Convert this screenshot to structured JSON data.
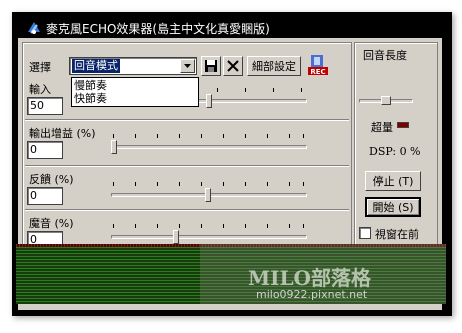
{
  "window": {
    "title": "麥克風ECHO效果器(島主中文化真愛睏版)"
  },
  "preset": {
    "label": "選擇",
    "value": "回音模式",
    "options": [
      "慢節奏",
      "快節奏"
    ]
  },
  "toolbar": {
    "settings_label": "細部設定"
  },
  "sliders": [
    {
      "label": "輸入",
      "value": "50",
      "level": 0.5
    },
    {
      "label": "輸出增益 (%)",
      "value": "0",
      "level": 0.0
    },
    {
      "label": "反饋 (%)",
      "value": "0",
      "level": 0.5
    },
    {
      "label": "魔音 (%)",
      "value": "0",
      "level": 0.33
    }
  ],
  "right": {
    "echo_length_label": "回音長度",
    "overload_label": "超量",
    "dsp_label": "DSP: 0 %",
    "stop_label": "停止 (T)",
    "start_label": "開始 (S)",
    "topmost_label": "視窗在前"
  },
  "watermark": {
    "title": "MILO部落格",
    "url": "milo0922.pixnet.net"
  },
  "colors": {
    "titlebar": "#000000",
    "selection": "#0a246a",
    "spectrum": "#2e7a1e",
    "peak": "#a01010"
  }
}
